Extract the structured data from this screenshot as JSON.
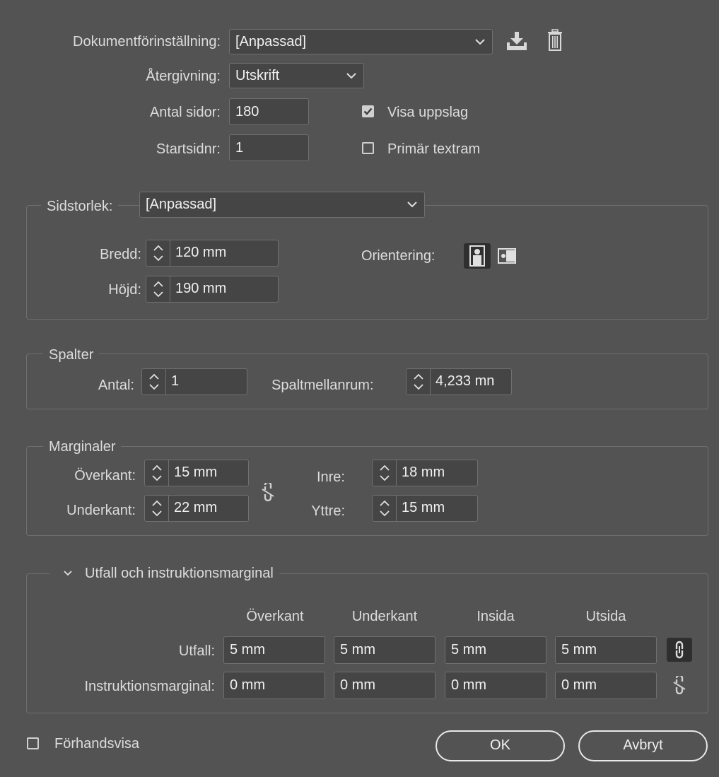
{
  "document": {
    "preset_label": "Dokumentförinställning:",
    "preset_value": "[Anpassad]",
    "render_label": "Återgivning:",
    "render_value": "Utskrift",
    "pages_label": "Antal sidor:",
    "pages_value": "180",
    "start_label": "Startsidnr:",
    "start_value": "1",
    "facing_label": "Visa uppslag",
    "facing_checked": true,
    "primary_label": "Primär textram",
    "primary_checked": false
  },
  "page_size": {
    "label": "Sidstorlek:",
    "value": "[Anpassad]",
    "width_label": "Bredd:",
    "width_value": "120 mm",
    "height_label": "Höjd:",
    "height_value": "190 mm",
    "orientation_label": "Orientering:"
  },
  "columns": {
    "title": "Spalter",
    "count_label": "Antal:",
    "count_value": "1",
    "gutter_label": "Spaltmellanrum:",
    "gutter_value": "4,233 mn"
  },
  "margins": {
    "title": "Marginaler",
    "top_label": "Överkant:",
    "top_value": "15 mm",
    "bottom_label": "Underkant:",
    "bottom_value": "22 mm",
    "inside_label": "Inre:",
    "inside_value": "18 mm",
    "outside_label": "Yttre:",
    "outside_value": "15 mm"
  },
  "bleed": {
    "title": "Utfall och instruktionsmarginal",
    "headers": [
      "Överkant",
      "Underkant",
      "Insida",
      "Utsida"
    ],
    "bleed_label": "Utfall:",
    "bleed_values": [
      "5 mm",
      "5 mm",
      "5 mm",
      "5 mm"
    ],
    "slug_label": "Instruktionsmarginal:",
    "slug_values": [
      "0 mm",
      "0 mm",
      "0 mm",
      "0 mm"
    ]
  },
  "footer": {
    "preview_label": "Förhandsvisa",
    "preview_checked": false,
    "ok_label": "OK",
    "cancel_label": "Avbryt"
  },
  "colors": {
    "background": "#535353",
    "field": "#454545",
    "border": "#707070",
    "text": "#dcdcdc"
  }
}
